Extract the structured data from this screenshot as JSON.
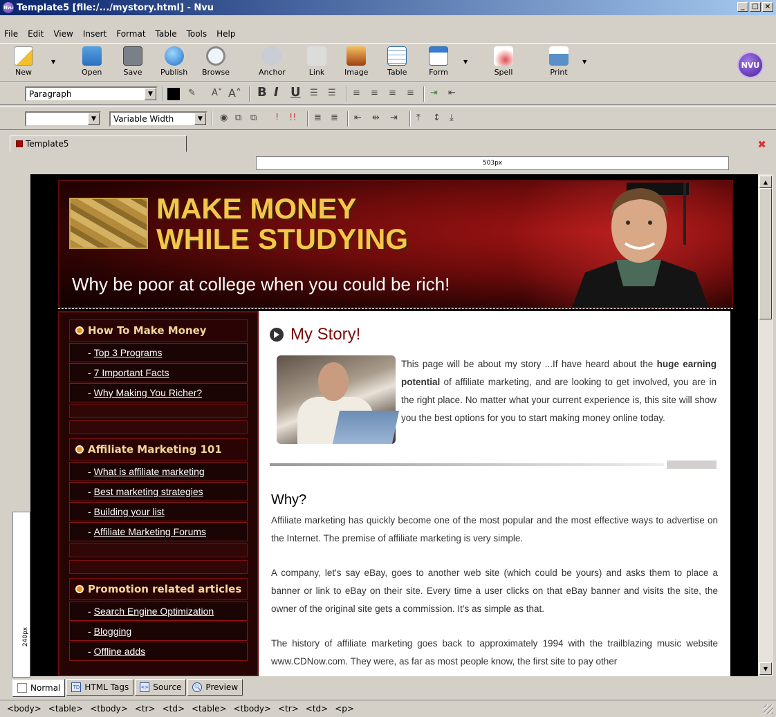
{
  "window": {
    "title": "Template5 [file:/.../mystory.html] - Nvu"
  },
  "menu": [
    "File",
    "Edit",
    "View",
    "Insert",
    "Format",
    "Table",
    "Tools",
    "Help"
  ],
  "toolbar": {
    "new": "New",
    "open": "Open",
    "save": "Save",
    "publish": "Publish",
    "browse": "Browse",
    "anchor": "Anchor",
    "link": "Link",
    "image": "Image",
    "table": "Table",
    "form": "Form",
    "spell": "Spell",
    "print": "Print",
    "logo": "NVU"
  },
  "format": {
    "paragraph_style": "Paragraph",
    "font_select": "",
    "font_family": "Variable Width"
  },
  "tab": {
    "title": "Template5"
  },
  "ruler": {
    "width_label": "503px",
    "height_label": "240px"
  },
  "page": {
    "banner_title_line1": "MAKE MONEY",
    "banner_title_line2": "WHILE STUDYING",
    "banner_tagline": "Why be poor at college when you could be rich!",
    "nav": [
      {
        "heading": "How To Make Money",
        "items": [
          "Top 3 Programs",
          "7 Important Facts",
          "Why Making You Richer?"
        ]
      },
      {
        "heading": "Affiliate Marketing 101",
        "items": [
          "What is affiliate marketing",
          "Best marketing strategies",
          "Building your list",
          "Affiliate Marketing Forums"
        ]
      },
      {
        "heading": "Promotion related articles",
        "items": [
          "Search Engine Optimization",
          "Blogging",
          "Offline adds"
        ]
      }
    ],
    "story_heading": "My Story!",
    "story_text_a": "This page will be about my story ...If have heard about the ",
    "story_text_bold": "huge earning potential",
    "story_text_b": " of affiliate marketing, and are looking to get involved, you are in the right place. No matter what your current experience is, this site will show you the best options for you to start making money online today.",
    "why_heading": "Why?",
    "para1": "Affiliate marketing has quickly become one of the most popular and the most effective ways to advertise on the Internet. The premise of affiliate marketing is very simple.",
    "para2": "A company, let's say eBay, goes to another web site (which could be yours) and asks them to place a banner or link to eBay on their site. Every time a user clicks on that eBay banner and visits the site, the owner of the original site gets a commission. It's as simple as that.",
    "para3": "The history of affiliate marketing goes back to approximately 1994 with the trailblazing music website www.CDNow.com. They were, as far as most people know, the first site to pay other"
  },
  "mode_tabs": [
    "Normal",
    "HTML Tags",
    "Source",
    "Preview"
  ],
  "status_tags": [
    "<body>",
    "<table>",
    "<tbody>",
    "<tr>",
    "<td>",
    "<table>",
    "<tbody>",
    "<tr>",
    "<td>",
    "<p>"
  ]
}
